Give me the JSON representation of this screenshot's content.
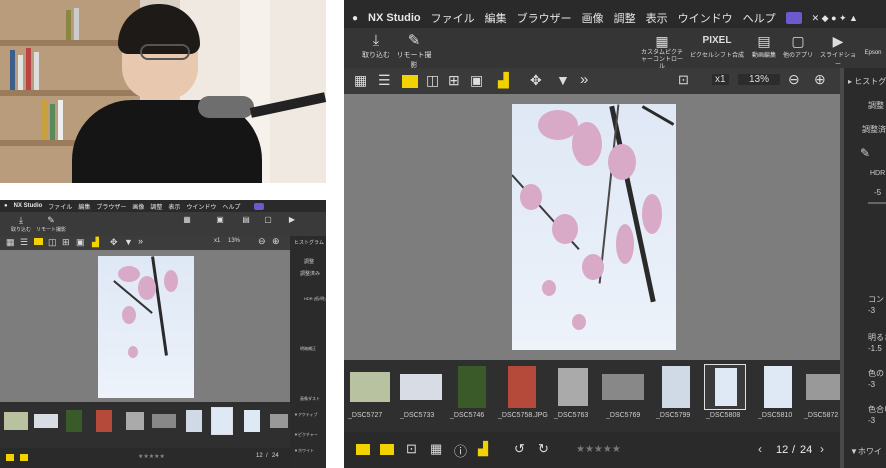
{
  "menu": {
    "app": "NX Studio",
    "items": [
      "ファイル",
      "編集",
      "ブラウザー",
      "画像",
      "調整",
      "表示",
      "ウインドウ",
      "ヘルプ"
    ]
  },
  "toolbar_left": [
    {
      "icon": "import-icon",
      "label": "取り込む"
    },
    {
      "icon": "remote-shoot-icon",
      "label": "リモート撮影"
    }
  ],
  "toolbar_right": [
    {
      "icon": "custom-picture-icon",
      "label": "カスタムピクチャーコントロール"
    },
    {
      "icon": "pixel-shift-icon",
      "label": "ピクセルシフト合成"
    },
    {
      "icon": "video-edit-icon",
      "label": "動画編集"
    },
    {
      "icon": "other-app-icon",
      "label": "他のアプリ"
    },
    {
      "icon": "slideshow-icon",
      "label": "スライドショー"
    },
    {
      "icon": "epson-icon",
      "label": "Epson"
    }
  ],
  "viewbar": {
    "zoom_mode": "x1",
    "zoom_level": "13%",
    "more": "»"
  },
  "filmstrip": [
    "_DSC5727",
    "_DSC5733",
    "_DSC5746",
    "_DSC5758.JPG",
    "_DSC5763",
    "_DSC5769",
    "_DSC5799",
    "_DSC5808",
    "_DSC5810",
    "_DSC5872"
  ],
  "pagination": {
    "current": "12",
    "sep": "/",
    "total": "24"
  },
  "right_panel": {
    "histogram_title": "ヒストグラム",
    "tab_adjust": "調整",
    "adjusted_label": "調整済み",
    "hdr": "HDR",
    "values": [
      "-5",
      "-3",
      "-1.5",
      "-3",
      "-3"
    ],
    "labels": [
      "コント",
      "明るさ",
      "色の",
      "色合い"
    ],
    "white_balance": "▼ホワイ"
  },
  "small_right_panel": {
    "histogram_title": "ヒストグラム",
    "adjust_tab": "調整",
    "adjusted": "調整済み",
    "hdr": "HDR (低/明)",
    "labels": [
      "明暗補正",
      "画像ダスト",
      "▼アクティブ",
      "▼ピクチャー",
      "▼ホワイト"
    ]
  },
  "rating_stars": "★★★★★",
  "colors": {
    "accent_yellow": "#f2d200",
    "menubar": "#2a2a2a",
    "toolbar": "#3a3a3a",
    "viewer_bg": "#7d7d7d",
    "badge_purple": "#6a5acd"
  }
}
